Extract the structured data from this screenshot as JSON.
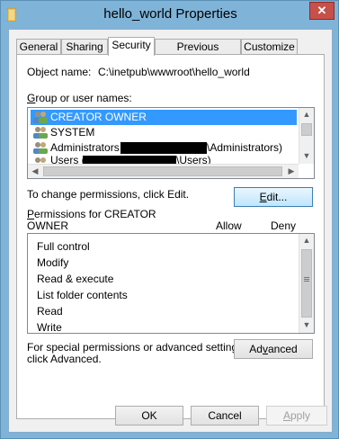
{
  "window": {
    "title": "hello_world Properties",
    "close_glyph": "✕"
  },
  "tabs": [
    "General",
    "Sharing",
    "Security",
    "Previous Versions",
    "Customize"
  ],
  "active_tab": "Security",
  "object_name": {
    "label": "Object name:",
    "value": "C:\\inetpub\\wwwroot\\hello_world"
  },
  "groups": {
    "label": "Group or user names:",
    "items": [
      {
        "pre": "CREATOR OWNER",
        "post": "",
        "selected": true
      },
      {
        "pre": "SYSTEM",
        "post": "",
        "selected": false
      },
      {
        "pre": "Administrators (",
        "post": "\\Administrators)",
        "selected": false
      },
      {
        "pre": "Users (",
        "post": "\\Users)",
        "selected": false
      }
    ]
  },
  "change_text": "To change permissions, click Edit.",
  "edit_button": "Edit...",
  "permissions": {
    "header_line1": "Permissions for CREATOR",
    "header_line2": "OWNER",
    "allow_label": "Allow",
    "deny_label": "Deny",
    "items": [
      "Full control",
      "Modify",
      "Read & execute",
      "List folder contents",
      "Read",
      "Write"
    ]
  },
  "advanced": {
    "text_line1": "For special permissions or advanced settings,",
    "text_line2": "click Advanced.",
    "button": "Advanced"
  },
  "buttons": {
    "ok": "OK",
    "cancel": "Cancel",
    "apply": "Apply"
  },
  "colors": {
    "selection": "#3399ff",
    "title_bar": "#7fb3d8",
    "close_button": "#c7504a"
  }
}
